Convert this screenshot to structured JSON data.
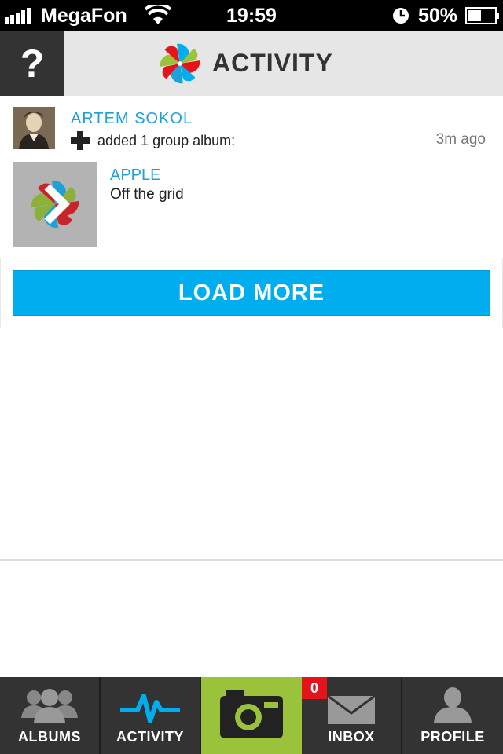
{
  "status_bar": {
    "carrier": "MegaFon",
    "time": "19:59",
    "battery": "50%",
    "battery_level": 0.5
  },
  "header": {
    "help_label": "?",
    "title": "ACTIVITY"
  },
  "activity": {
    "user_name": "ARTEM SOKOL",
    "action": "added 1 group album:",
    "time_ago": "3m ago",
    "album_owner": "APPLE",
    "album_title": "Off the grid"
  },
  "load_more_label": "LOAD MORE",
  "tabs": [
    {
      "label": "ALBUMS",
      "icon": "users-icon"
    },
    {
      "label": "ACTIVITY",
      "icon": "pulse-icon"
    },
    {
      "label": "",
      "icon": "camera-icon"
    },
    {
      "label": "INBOX",
      "icon": "envelope-icon"
    },
    {
      "label": "PROFILE",
      "icon": "user-icon"
    }
  ],
  "inbox_badge": "0",
  "colors": {
    "accent_blue": "#00aeef",
    "link_blue": "#1da2d8",
    "camera_green": "#9ac33b",
    "badge_red": "#e5141b",
    "dark": "#333333"
  }
}
